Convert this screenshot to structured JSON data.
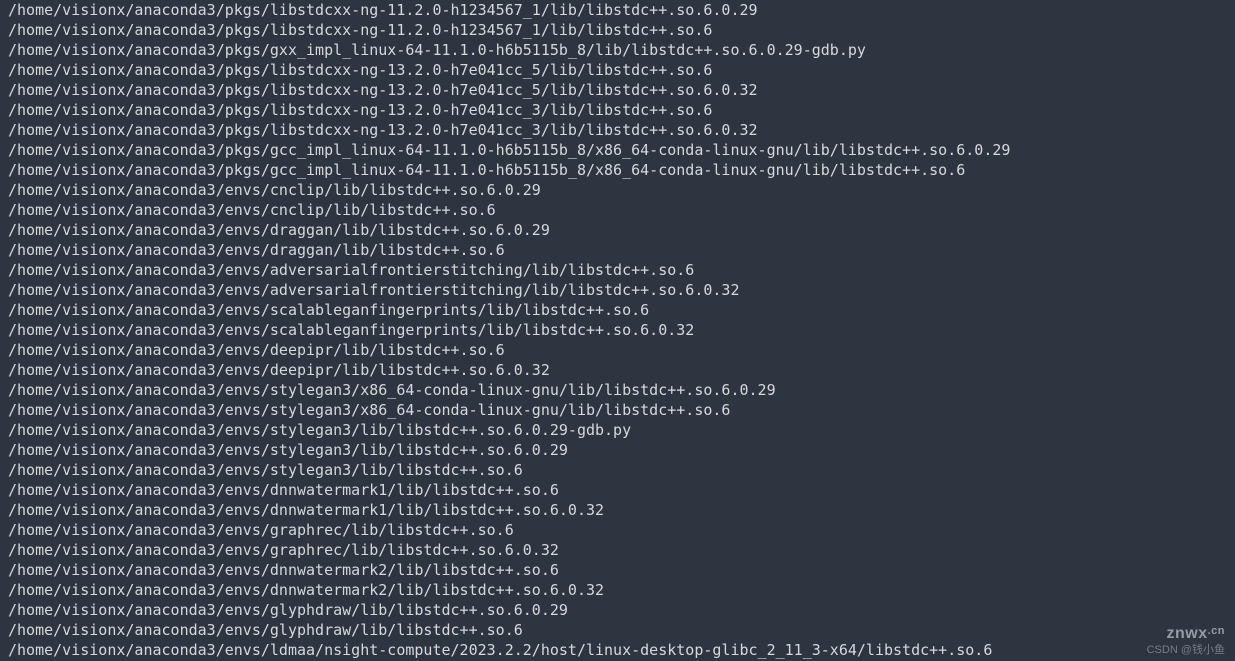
{
  "terminal": {
    "lines": [
      "/home/visionx/anaconda3/pkgs/libstdcxx-ng-11.2.0-h1234567_1/lib/libstdc++.so.6.0.29",
      "/home/visionx/anaconda3/pkgs/libstdcxx-ng-11.2.0-h1234567_1/lib/libstdc++.so.6",
      "/home/visionx/anaconda3/pkgs/gxx_impl_linux-64-11.1.0-h6b5115b_8/lib/libstdc++.so.6.0.29-gdb.py",
      "/home/visionx/anaconda3/pkgs/libstdcxx-ng-13.2.0-h7e041cc_5/lib/libstdc++.so.6",
      "/home/visionx/anaconda3/pkgs/libstdcxx-ng-13.2.0-h7e041cc_5/lib/libstdc++.so.6.0.32",
      "/home/visionx/anaconda3/pkgs/libstdcxx-ng-13.2.0-h7e041cc_3/lib/libstdc++.so.6",
      "/home/visionx/anaconda3/pkgs/libstdcxx-ng-13.2.0-h7e041cc_3/lib/libstdc++.so.6.0.32",
      "/home/visionx/anaconda3/pkgs/gcc_impl_linux-64-11.1.0-h6b5115b_8/x86_64-conda-linux-gnu/lib/libstdc++.so.6.0.29",
      "/home/visionx/anaconda3/pkgs/gcc_impl_linux-64-11.1.0-h6b5115b_8/x86_64-conda-linux-gnu/lib/libstdc++.so.6",
      "/home/visionx/anaconda3/envs/cnclip/lib/libstdc++.so.6.0.29",
      "/home/visionx/anaconda3/envs/cnclip/lib/libstdc++.so.6",
      "/home/visionx/anaconda3/envs/draggan/lib/libstdc++.so.6.0.29",
      "/home/visionx/anaconda3/envs/draggan/lib/libstdc++.so.6",
      "/home/visionx/anaconda3/envs/adversarialfrontierstitching/lib/libstdc++.so.6",
      "/home/visionx/anaconda3/envs/adversarialfrontierstitching/lib/libstdc++.so.6.0.32",
      "/home/visionx/anaconda3/envs/scalableganfingerprints/lib/libstdc++.so.6",
      "/home/visionx/anaconda3/envs/scalableganfingerprints/lib/libstdc++.so.6.0.32",
      "/home/visionx/anaconda3/envs/deepipr/lib/libstdc++.so.6",
      "/home/visionx/anaconda3/envs/deepipr/lib/libstdc++.so.6.0.32",
      "/home/visionx/anaconda3/envs/stylegan3/x86_64-conda-linux-gnu/lib/libstdc++.so.6.0.29",
      "/home/visionx/anaconda3/envs/stylegan3/x86_64-conda-linux-gnu/lib/libstdc++.so.6",
      "/home/visionx/anaconda3/envs/stylegan3/lib/libstdc++.so.6.0.29-gdb.py",
      "/home/visionx/anaconda3/envs/stylegan3/lib/libstdc++.so.6.0.29",
      "/home/visionx/anaconda3/envs/stylegan3/lib/libstdc++.so.6",
      "/home/visionx/anaconda3/envs/dnnwatermark1/lib/libstdc++.so.6",
      "/home/visionx/anaconda3/envs/dnnwatermark1/lib/libstdc++.so.6.0.32",
      "/home/visionx/anaconda3/envs/graphrec/lib/libstdc++.so.6",
      "/home/visionx/anaconda3/envs/graphrec/lib/libstdc++.so.6.0.32",
      "/home/visionx/anaconda3/envs/dnnwatermark2/lib/libstdc++.so.6",
      "/home/visionx/anaconda3/envs/dnnwatermark2/lib/libstdc++.so.6.0.32",
      "/home/visionx/anaconda3/envs/glyphdraw/lib/libstdc++.so.6.0.29",
      "/home/visionx/anaconda3/envs/glyphdraw/lib/libstdc++.so.6",
      "/home/visionx/anaconda3/envs/ldmaa/nsight-compute/2023.2.2/host/linux-desktop-glibc_2_11_3-x64/libstdc++.so.6"
    ]
  },
  "watermarks": {
    "top": "znwx",
    "top_suffix": ".cn",
    "bottom": "CSDN @钱小鱼"
  }
}
